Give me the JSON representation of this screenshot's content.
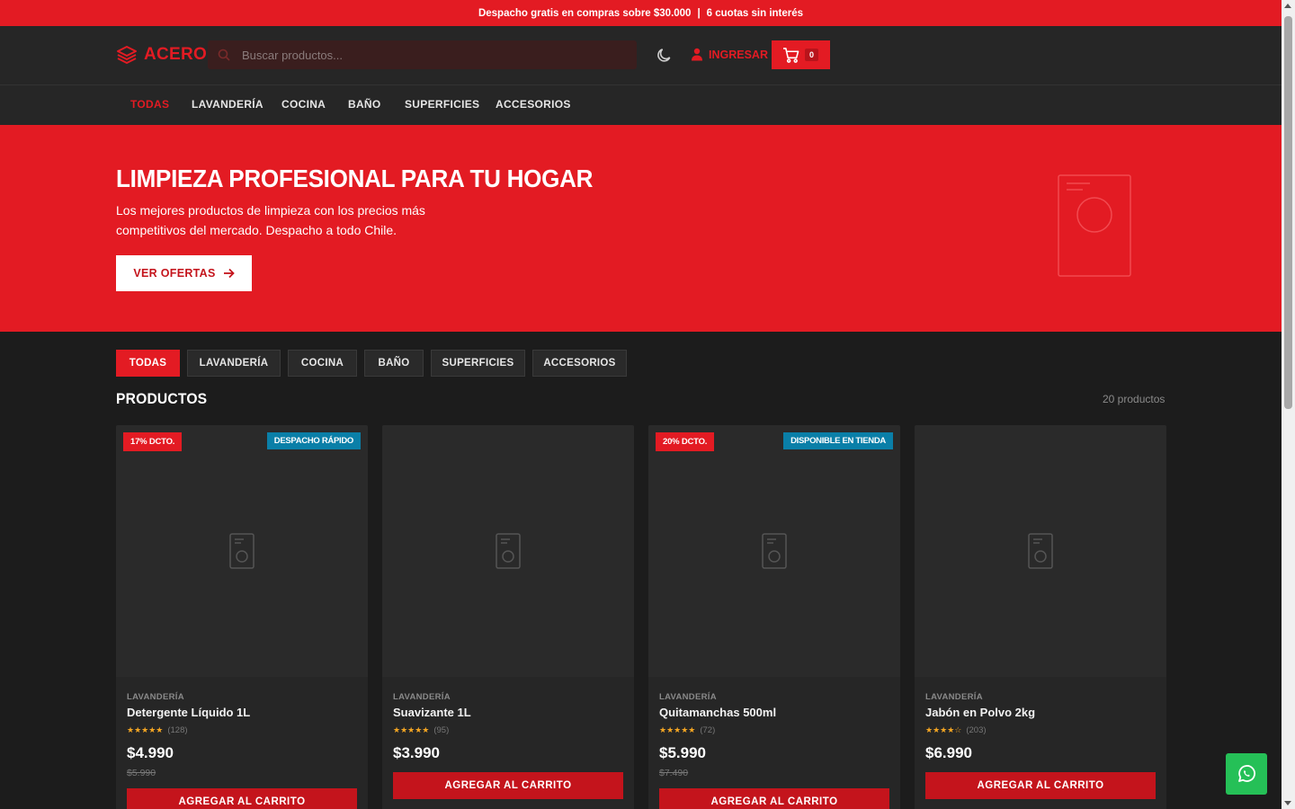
{
  "topbar": {
    "shipping": "Despacho gratis en compras sobre $30.000",
    "separator": "|",
    "installments": "6 cuotas sin interés"
  },
  "header": {
    "logo": "ACERO",
    "search_placeholder": "Buscar productos...",
    "login_label": "INGRESAR",
    "cart_count": "0"
  },
  "nav": {
    "items": [
      "TODAS",
      "LAVANDERÍA",
      "COCINA",
      "BAÑO",
      "SUPERFICIES",
      "ACCESORIOS"
    ]
  },
  "hero": {
    "title": "LIMPIEZA PROFESIONAL PARA TU HOGAR",
    "subtitle": "Los mejores productos de limpieza con los precios más competitivos del mercado. Despacho a todo Chile.",
    "cta": "VER OFERTAS"
  },
  "filters": [
    "TODAS",
    "LAVANDERÍA",
    "COCINA",
    "BAÑO",
    "SUPERFICIES",
    "ACCESORIOS"
  ],
  "products_section": {
    "title": "PRODUCTOS",
    "count": "20 productos"
  },
  "products": [
    {
      "badge_left": "17% DCTO.",
      "badge_right": "DESPACHO RÁPIDO",
      "category": "LAVANDERÍA",
      "name": "Detergente Líquido 1L",
      "stars": "★★★★★",
      "reviews": "(128)",
      "price": "$4.990",
      "old_price": "$5.990",
      "button": "AGREGAR AL CARRITO"
    },
    {
      "badge_left": "",
      "badge_right": "",
      "category": "LAVANDERÍA",
      "name": "Suavizante 1L",
      "stars": "★★★★★",
      "reviews": "(95)",
      "price": "$3.990",
      "old_price": "",
      "button": "AGREGAR AL CARRITO"
    },
    {
      "badge_left": "20% DCTO.",
      "badge_right": "DISPONIBLE EN TIENDA",
      "category": "LAVANDERÍA",
      "name": "Quitamanchas 500ml",
      "stars": "★★★★★",
      "reviews": "(72)",
      "price": "$5.990",
      "old_price": "$7.490",
      "button": "AGREGAR AL CARRITO"
    },
    {
      "badge_left": "",
      "badge_right": "",
      "category": "LAVANDERÍA",
      "name": "Jabón en Polvo 2kg",
      "stars": "★★★★☆",
      "reviews": "(203)",
      "price": "$6.990",
      "old_price": "",
      "button": "AGREGAR AL CARRITO"
    }
  ],
  "colors": {
    "brand_red": "#e31b23",
    "button_red": "#c4141c",
    "badge_blue": "#0a7fa8",
    "whatsapp_green": "#25c057",
    "star": "#f5a623"
  }
}
